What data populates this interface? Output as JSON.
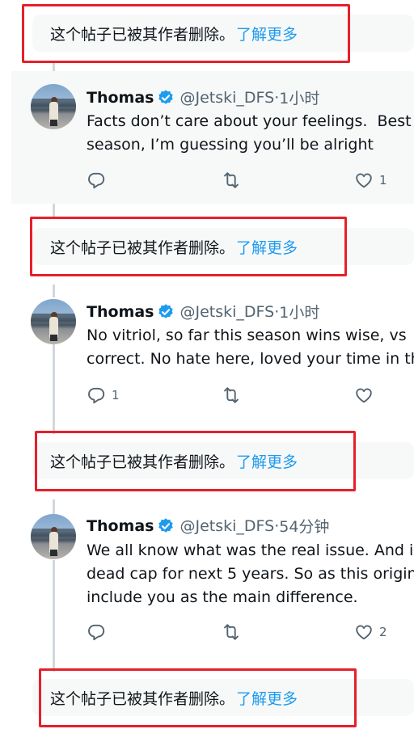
{
  "deleted_notice": {
    "text": "这个帖子已被其作者删除。",
    "link": "了解更多"
  },
  "tweets": [
    {
      "name": "Thomas",
      "handle": "@Jetski_DFS",
      "time": "1小时",
      "lines": [
        "Facts don’t care about your feelings.  Best",
        "season, I’m guessing you’ll be alright"
      ],
      "replies": "",
      "retweets": "",
      "likes": "1"
    },
    {
      "name": "Thomas",
      "handle": "@Jetski_DFS",
      "time": "1小时",
      "lines": [
        "No vitriol, so far this season wins wise, vs",
        "correct. No hate here, loved your time in th"
      ],
      "replies": "1",
      "retweets": "",
      "likes": ""
    },
    {
      "name": "Thomas",
      "handle": "@Jetski_DFS",
      "time": "54分钟",
      "lines": [
        "We all know what was the real issue. And i",
        "dead cap for next 5 years. So as this origin",
        "include you as the main difference."
      ],
      "replies": "",
      "retweets": "",
      "likes": "2"
    }
  ],
  "separator": " · ",
  "colors": {
    "accent": "#1d9bf0",
    "highlight": "#e5202a",
    "muted": "#536471",
    "panel": "#f7f9f9"
  },
  "icons": [
    "verified-badge-icon",
    "reply-icon",
    "retweet-icon",
    "like-icon"
  ]
}
